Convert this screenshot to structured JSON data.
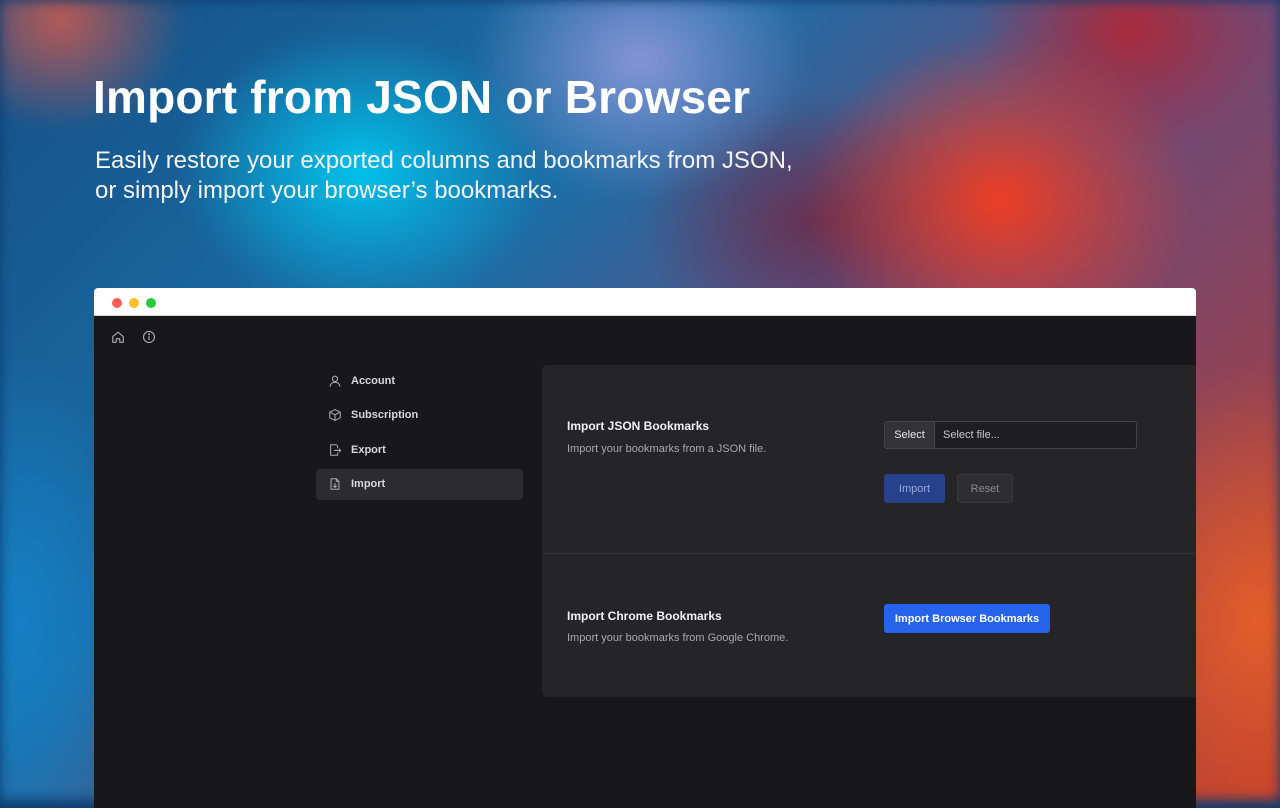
{
  "hero": {
    "title": "Import from JSON or Browser",
    "subtitle_line1": "Easily restore your exported columns and bookmarks from JSON,",
    "subtitle_line2": "or simply import your browser’s bookmarks."
  },
  "window": {
    "topbar": {
      "icons": [
        "home-icon",
        "info-icon"
      ]
    },
    "sidebar": {
      "items": [
        {
          "label": "Account",
          "icon": "user-icon",
          "active": false
        },
        {
          "label": "Subscription",
          "icon": "box-icon",
          "active": false
        },
        {
          "label": "Export",
          "icon": "export-icon",
          "active": false
        },
        {
          "label": "Import",
          "icon": "import-icon",
          "active": true
        }
      ]
    },
    "json_section": {
      "title": "Import JSON Bookmarks",
      "description": "Import your bookmarks from a JSON file.",
      "file_select_label": "Select",
      "file_placeholder": "Select file...",
      "import_label": "Import",
      "reset_label": "Reset"
    },
    "chrome_section": {
      "title": "Import Chrome Bookmarks",
      "description": "Import your bookmarks from Google Chrome.",
      "button_label": "Import Browser Bookmarks"
    }
  },
  "colors": {
    "accent": "#2563eb",
    "accent_disabled": "#27418a",
    "window_bg": "#18181b",
    "panel_bg": "#252528"
  }
}
